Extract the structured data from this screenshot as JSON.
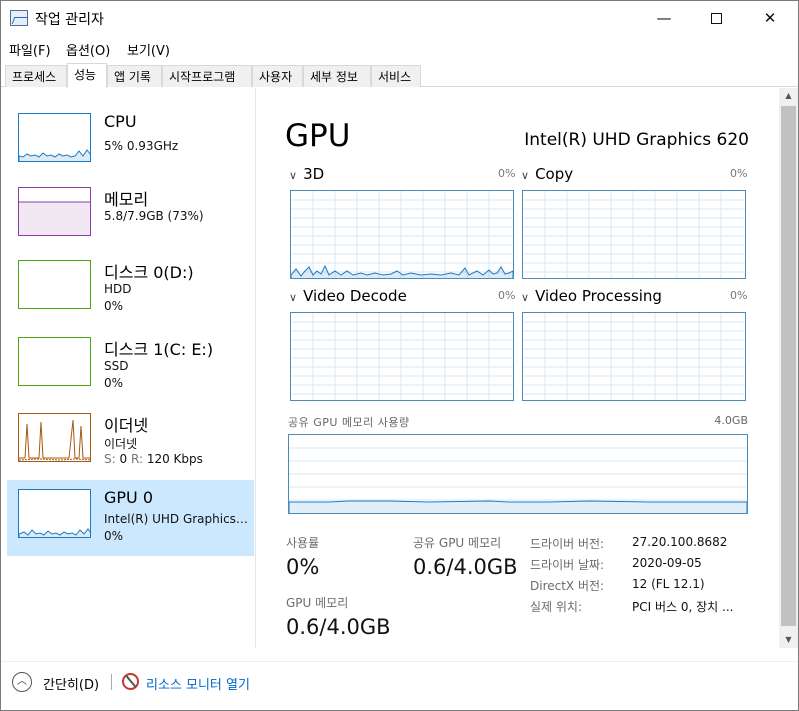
{
  "window": {
    "title": "작업 관리자",
    "minimize": "—",
    "close": "✕"
  },
  "menu": [
    "파일(F)",
    "옵션(O)",
    "보기(V)"
  ],
  "tabs": [
    "프로세스",
    "성능",
    "앱 기록",
    "시작프로그램",
    "사용자",
    "세부 정보",
    "서비스"
  ],
  "active_tab": "성능",
  "sidebar": [
    {
      "title": "CPU",
      "line1": "5%  0.93GHz",
      "color": "#1b7bc5"
    },
    {
      "title": "메모리",
      "line1": "5.8/7.9GB (73%)",
      "color": "#8b3ea8"
    },
    {
      "title": "디스크 0(D:)",
      "line1": "HDD",
      "line2": "0%",
      "color": "#4da60c"
    },
    {
      "title": "디스크 1(C: E:)",
      "line1": "SSD",
      "line2": "0%",
      "color": "#4da60c"
    },
    {
      "title": "이더넷",
      "line1": "이더넷",
      "line2_s": "S:",
      "line2_sv": "0",
      "line2_r": "R:",
      "line2_rv": "120 Kbps",
      "color": "#a8590f"
    },
    {
      "title": "GPU 0",
      "line1": "Intel(R) UHD Graphics…",
      "line2": "0%",
      "color": "#1b7bc5"
    }
  ],
  "main": {
    "heading": "GPU",
    "gpu_name": "Intel(R) UHD Graphics 620",
    "engines": [
      {
        "label": "3D",
        "pct": "0%"
      },
      {
        "label": "Copy",
        "pct": "0%"
      },
      {
        "label": "Video Decode",
        "pct": "0%"
      },
      {
        "label": "Video Processing",
        "pct": "0%"
      }
    ],
    "shared_label": "공유 GPU 메모리 사용량",
    "shared_max": "4.0GB",
    "stats": {
      "usage_label": "사용률",
      "usage_value": "0%",
      "shared_label": "공유 GPU 메모리",
      "shared_value": "0.6/4.0GB",
      "dedicated_label": "GPU 메모리",
      "dedicated_value": "0.6/4.0GB"
    },
    "info": [
      {
        "key": "드라이버 버전:",
        "val": "27.20.100.8682"
      },
      {
        "key": "드라이버 날짜:",
        "val": "2020-09-05"
      },
      {
        "key": "DirectX 버전:",
        "val": "12 (FL 12.1)"
      },
      {
        "key": "실제 위치:",
        "val": "PCI 버스 0, 장치 ..."
      }
    ]
  },
  "footer": {
    "collapse": "간단히(D)",
    "resmon": "리소스 모니터 열기"
  }
}
